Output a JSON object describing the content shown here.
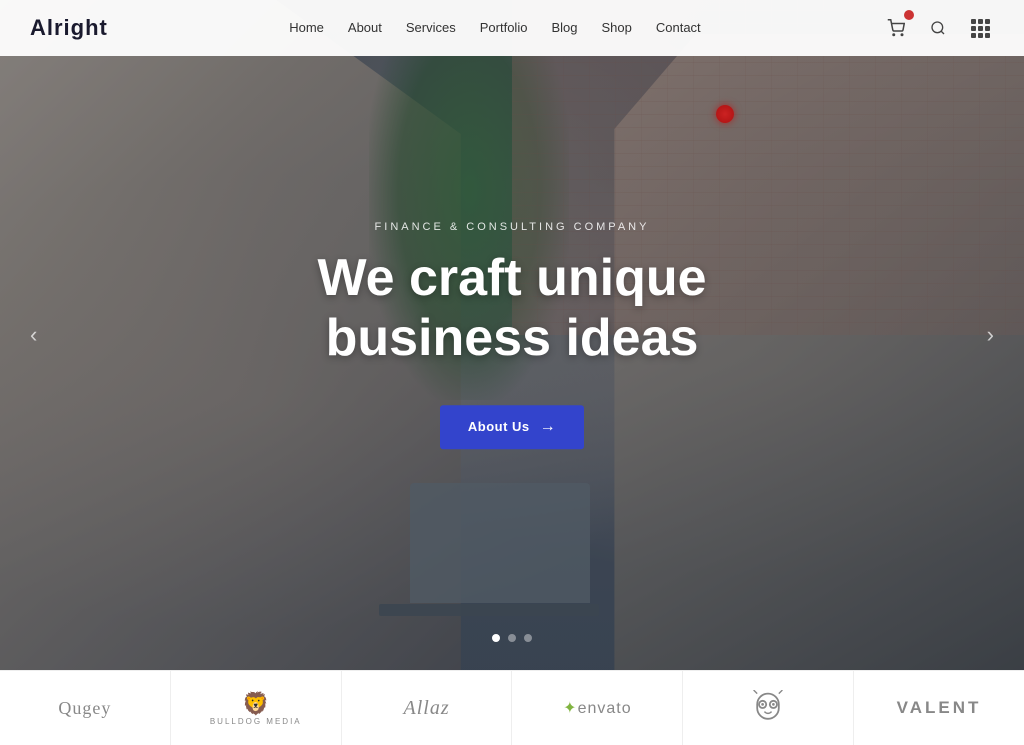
{
  "brand": {
    "logo": "Alright"
  },
  "navbar": {
    "menu": [
      {
        "label": "Home",
        "href": "#"
      },
      {
        "label": "About",
        "href": "#"
      },
      {
        "label": "Services",
        "href": "#"
      },
      {
        "label": "Portfolio",
        "href": "#"
      },
      {
        "label": "Blog",
        "href": "#"
      },
      {
        "label": "Shop",
        "href": "#"
      },
      {
        "label": "Contact",
        "href": "#"
      }
    ]
  },
  "hero": {
    "subtitle": "Finance & Consulting Company",
    "title_line1": "We craft unique",
    "title_line2": "business ideas",
    "cta_label": "About Us",
    "prev_arrow": "‹",
    "next_arrow": "›",
    "dots": [
      {
        "active": true
      },
      {
        "active": false
      },
      {
        "active": false
      }
    ]
  },
  "logos": [
    {
      "text": "Qugey",
      "style": "serif"
    },
    {
      "text": "🦁",
      "sub": "BULLDOG MEDIA",
      "style": "icon"
    },
    {
      "text": "Allaz",
      "style": "script"
    },
    {
      "text": "✦envato",
      "style": "normal"
    },
    {
      "text": "🦅",
      "style": "icon-only"
    },
    {
      "text": "VALENT",
      "style": "caps"
    }
  ]
}
